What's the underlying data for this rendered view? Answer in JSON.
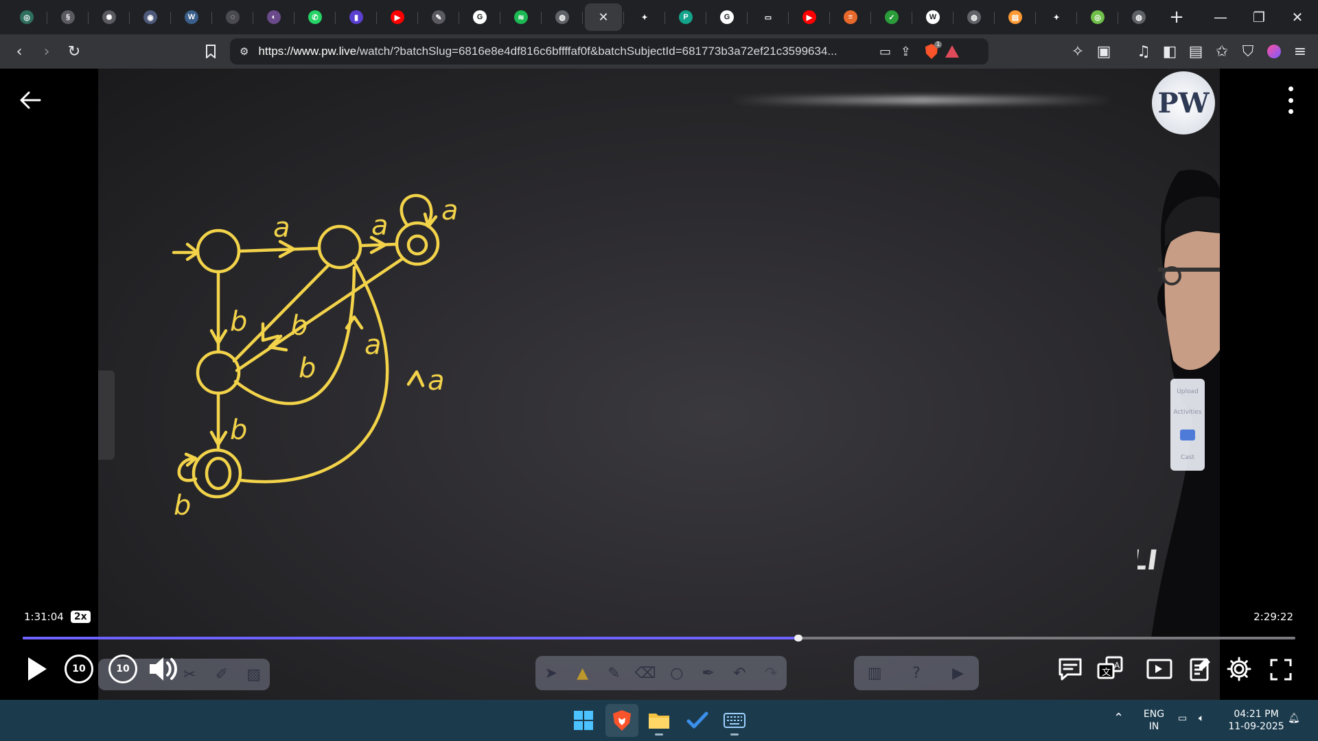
{
  "browser": {
    "tabs": [
      {
        "icon": "chatgpt-icon",
        "color": "#2f6f5e",
        "glyph": "◎"
      },
      {
        "icon": "spiral-site-icon",
        "color": "#5a5a60",
        "glyph": "§"
      },
      {
        "icon": "openai-icon",
        "color": "#5a5a60",
        "glyph": "✺"
      },
      {
        "icon": "globe-site-icon",
        "color": "#4e5a7a",
        "glyph": "◉"
      },
      {
        "icon": "wordpress-icon",
        "color": "#3a5f8a",
        "glyph": "W"
      },
      {
        "icon": "circle-site-icon",
        "color": "#4a4a50",
        "glyph": "◌"
      },
      {
        "icon": "purple-site-icon",
        "color": "#6a4a8a",
        "glyph": "◐"
      },
      {
        "icon": "whatsapp-icon",
        "color": "#25d366",
        "glyph": "✆"
      },
      {
        "icon": "bookmark-site-icon",
        "color": "#5b3fd1",
        "glyph": "▮"
      },
      {
        "icon": "youtube-icon",
        "color": "#ff0000",
        "glyph": "▶"
      },
      {
        "icon": "scribble-site-icon",
        "color": "#5a5a60",
        "glyph": "✎"
      },
      {
        "icon": "google-icon",
        "color": "#ffffff",
        "glyph": "G"
      },
      {
        "icon": "spotify-icon",
        "color": "#1db954",
        "glyph": "≋"
      },
      {
        "icon": "globe-icon",
        "color": "#5f6368",
        "glyph": "◍"
      },
      {
        "icon": "close-icon",
        "active": true
      },
      {
        "icon": "gemini-icon",
        "color": "#202124",
        "glyph": "✦"
      },
      {
        "icon": "perplexity-icon",
        "color": "#14a38b",
        "glyph": "P"
      },
      {
        "icon": "google-icon",
        "color": "#ffffff",
        "glyph": "G"
      },
      {
        "icon": "monitor-icon",
        "color": "#202124",
        "glyph": "▭"
      },
      {
        "icon": "youtube-icon",
        "color": "#ff0000",
        "glyph": "▶"
      },
      {
        "icon": "orange-site-icon",
        "color": "#e8692c",
        "glyph": "≡"
      },
      {
        "icon": "green-site-icon",
        "color": "#2a9d3a",
        "glyph": "✓"
      },
      {
        "icon": "wikipedia-icon",
        "color": "#ffffff",
        "glyph": "W"
      },
      {
        "icon": "globe-icon",
        "color": "#5f6368",
        "glyph": "◍"
      },
      {
        "icon": "india-flag-icon",
        "color": "#ff9933",
        "glyph": "▤"
      },
      {
        "icon": "gemini-icon",
        "color": "#202124",
        "glyph": "✦"
      },
      {
        "icon": "green-circle-site-icon",
        "color": "#6fbf4a",
        "glyph": "◎"
      },
      {
        "icon": "globe-icon",
        "color": "#5f6368",
        "glyph": "◍"
      }
    ],
    "url_host": "https://www.pw.live",
    "url_rest": "/watch/?batchSlug=6816e8e4df816c6bffffaf0f&batchSubjectId=681773b3a72ef21c3599634...",
    "brave_shield_count": "1"
  },
  "player": {
    "current_time": "1:31:04",
    "speed": "2x",
    "total_time": "2:29:22",
    "progress_fraction": 0.6095,
    "buffered_fraction": 0.612,
    "skip_back": "10",
    "skip_forward": "10",
    "side_panel": {
      "upload": "Upload",
      "activities": "Activities",
      "cast": "Cast"
    },
    "logo_text": "PW"
  },
  "board": {
    "transition_labels": [
      "a",
      "a",
      "a",
      "b",
      "b",
      "b",
      "a",
      "a",
      "b",
      "b"
    ]
  },
  "system": {
    "lang_top": "ENG",
    "lang_bottom": "IN",
    "time": "04:21 PM",
    "date": "11-09-2025"
  },
  "colors": {
    "accent_progress": "#6f63ff",
    "chalk": "#f2d34a",
    "taskbar": "#1b3b4d"
  }
}
